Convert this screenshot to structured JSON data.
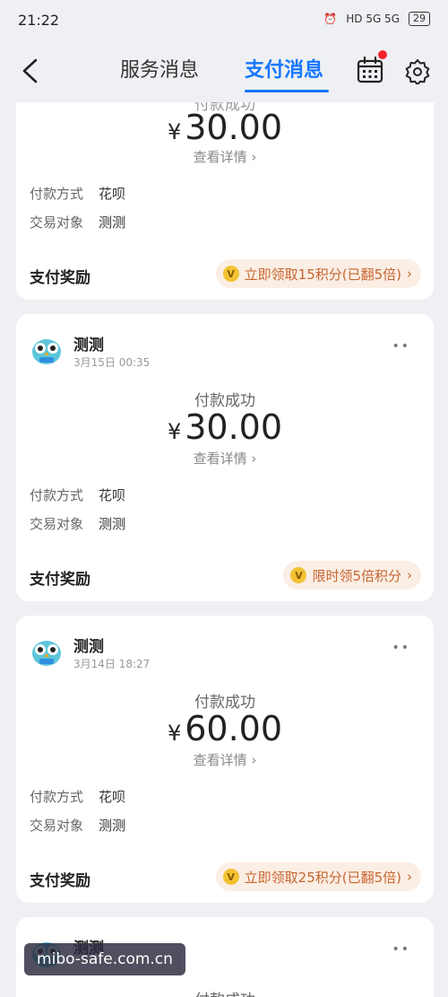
{
  "status_bar": {
    "time": "21:22",
    "signal_text": "HD 5G 5G",
    "battery": "29"
  },
  "nav": {
    "tab_service": "服务消息",
    "tab_pay": "支付消息",
    "accent_color": "#1677ff"
  },
  "cards": [
    {
      "merchant": "",
      "time": "",
      "status": "付款成功",
      "currency": "¥",
      "amount": "30.00",
      "detail": "查看详情",
      "method_label": "付款方式",
      "method_value": "花呗",
      "party_label": "交易对象",
      "party_value": "测测",
      "reward_title": "支付奖励",
      "reward_text": "立即领取15积分(已翻5倍)"
    },
    {
      "merchant": "测测",
      "time": "3月15日 00:35",
      "status": "付款成功",
      "currency": "¥",
      "amount": "30.00",
      "detail": "查看详情",
      "method_label": "付款方式",
      "method_value": "花呗",
      "party_label": "交易对象",
      "party_value": "测测",
      "reward_title": "支付奖励",
      "reward_text": "限时领5倍积分"
    },
    {
      "merchant": "测测",
      "time": "3月14日 18:27",
      "status": "付款成功",
      "currency": "¥",
      "amount": "60.00",
      "detail": "查看详情",
      "method_label": "付款方式",
      "method_value": "花呗",
      "party_label": "交易对象",
      "party_value": "测测",
      "reward_title": "支付奖励",
      "reward_text": "立即领取25积分(已翻5倍)"
    },
    {
      "merchant": "测测",
      "status": "付款成功"
    }
  ],
  "watermark": "mibo-safe.com.cn"
}
